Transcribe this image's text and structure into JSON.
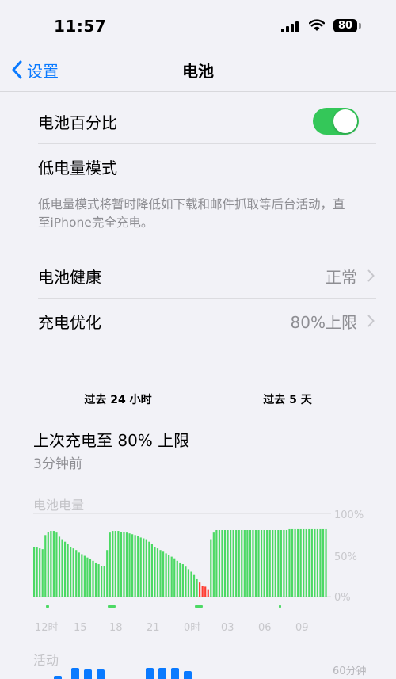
{
  "status_bar": {
    "time": "11:57",
    "battery_level": "80"
  },
  "nav": {
    "back_label": "设置",
    "title": "电池"
  },
  "settings": {
    "battery_percentage_label": "电池百分比",
    "battery_percentage_on": true,
    "low_power_label": "低电量模式",
    "low_power_footnote": "低电量模式将暂时降低如下载和邮件抓取等后台活动，直至iPhone完全充电。",
    "battery_health_label": "电池健康",
    "battery_health_value": "正常",
    "charge_opt_label": "充电优化",
    "charge_opt_value": "80%上限"
  },
  "segments": {
    "left": "过去 24 小时",
    "right": "过去 5 天"
  },
  "last_charge": {
    "title": "上次充电至 80% 上限",
    "time": "3分钟前"
  },
  "battery_chart": {
    "title": "电池电量",
    "y_ticks": [
      "100%",
      "50%",
      "0%"
    ],
    "x_ticks": [
      "12时",
      "15",
      "18",
      "21",
      "0时",
      "03",
      "06",
      "09"
    ]
  },
  "activity": {
    "title": "活动",
    "y_tick": "60分钟"
  },
  "chart_data": {
    "type": "bar",
    "title": "电池电量",
    "ylim": [
      0,
      100
    ],
    "x_ticks": [
      "12时",
      "15",
      "18",
      "21",
      "0时",
      "03",
      "06",
      "09"
    ],
    "values": [
      60,
      59,
      58,
      57,
      74,
      78,
      79,
      79,
      77,
      72,
      69,
      66,
      63,
      60,
      58,
      56,
      53,
      51,
      49,
      47,
      45,
      43,
      41,
      39,
      37,
      37,
      56,
      77,
      79,
      79,
      79,
      78,
      78,
      77,
      76,
      75,
      74,
      73,
      71,
      70,
      69,
      66,
      63,
      60,
      58,
      56,
      54,
      52,
      50,
      48,
      46,
      43,
      41,
      39,
      36,
      33,
      30,
      26,
      21,
      17,
      13,
      12,
      8,
      69,
      77,
      80,
      80,
      80,
      80,
      80,
      80,
      80,
      80,
      80,
      80,
      80,
      80,
      80,
      80,
      80,
      80,
      80,
      80,
      80,
      80,
      80,
      80,
      80,
      80,
      80,
      80,
      81,
      81,
      81,
      81,
      81,
      81,
      81,
      81,
      81,
      81,
      81,
      81,
      81,
      81
    ],
    "low_threshold": 20,
    "colors": {
      "normal": "#4cd964",
      "low": "#ff3b30"
    }
  }
}
